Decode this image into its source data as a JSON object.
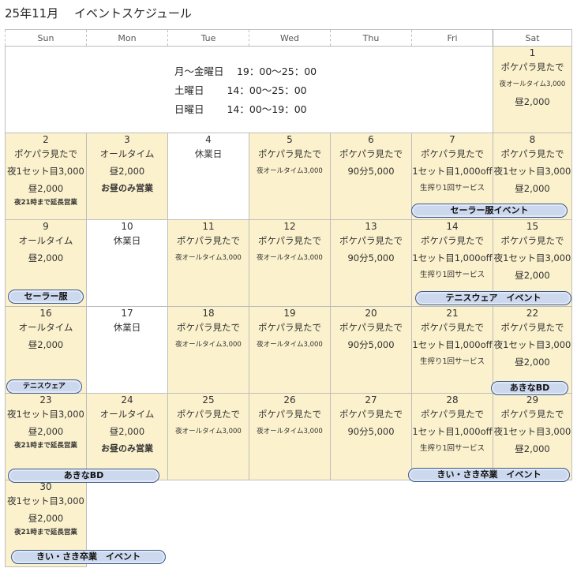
{
  "title": "25年11月　 イベントスケジュール",
  "weekdays": [
    "Sun",
    "Mon",
    "Tue",
    "Wed",
    "Thu",
    "Fri",
    "Sat"
  ],
  "hours": [
    "月～金曜日　 19：00～25：00",
    "土曜日　　 14：00～25：00",
    "日曜日　　 14：00～19：00"
  ],
  "days": {
    "d1": {
      "num": "1",
      "lines": [
        "ポケパラ見たで",
        "夜オールタイム3,000",
        "昼2,000"
      ]
    },
    "d2": {
      "num": "2",
      "lines": [
        "ポケパラ見たで",
        "夜1セット目3,000",
        "昼2,000",
        "夜21時まで延長営業"
      ]
    },
    "d3": {
      "num": "3",
      "lines": [
        "オールタイム",
        "昼2,000",
        "お昼のみ営業"
      ]
    },
    "d4": {
      "num": "4",
      "lines": [
        "休業日"
      ]
    },
    "d5": {
      "num": "5",
      "lines": [
        "ポケパラ見たで",
        "夜オールタイム3,000"
      ]
    },
    "d6": {
      "num": "6",
      "lines": [
        "ポケパラ見たで",
        "90分5,000"
      ]
    },
    "d7": {
      "num": "7",
      "lines": [
        "ポケパラ見たで",
        "1セット目1,000off",
        "生搾り1回サービス"
      ]
    },
    "d8": {
      "num": "8",
      "lines": [
        "ポケパラ見たで",
        "夜1セット目3,000",
        "昼2,000"
      ]
    },
    "d9": {
      "num": "9",
      "lines": [
        "オールタイム",
        "昼2,000"
      ]
    },
    "d10": {
      "num": "10",
      "lines": [
        "休業日"
      ]
    },
    "d11": {
      "num": "11",
      "lines": [
        "ポケパラ見たで",
        "夜オールタイム3,000"
      ]
    },
    "d12": {
      "num": "12",
      "lines": [
        "ポケパラ見たで",
        "夜オールタイム3,000"
      ]
    },
    "d13": {
      "num": "13",
      "lines": [
        "ポケパラ見たで",
        "90分5,000"
      ]
    },
    "d14": {
      "num": "14",
      "lines": [
        "ポケパラ見たで",
        "1セット目1,000off",
        "生搾り1回サービス"
      ]
    },
    "d15": {
      "num": "15",
      "lines": [
        "ポケパラ見たで",
        "夜1セット目3,000",
        "昼2,000"
      ]
    },
    "d16": {
      "num": "16",
      "lines": [
        "オールタイム",
        "昼2,000"
      ]
    },
    "d17": {
      "num": "17",
      "lines": [
        "休業日"
      ]
    },
    "d18": {
      "num": "18",
      "lines": [
        "ポケパラ見たで",
        "夜オールタイム3,000"
      ]
    },
    "d19": {
      "num": "19",
      "lines": [
        "ポケパラ見たで",
        "夜オールタイム3,000"
      ]
    },
    "d20": {
      "num": "20",
      "lines": [
        "ポケパラ見たで",
        "90分5,000"
      ]
    },
    "d21": {
      "num": "21",
      "lines": [
        "ポケパラ見たで",
        "1セット目1,000off",
        "生搾り1回サービス"
      ]
    },
    "d22": {
      "num": "22",
      "lines": [
        "ポケパラ見たで",
        "夜1セット目3,000",
        "昼2,000"
      ]
    },
    "d23": {
      "num": "23",
      "lines": [
        "夜1セット目3,000",
        "昼2,000",
        "夜21時まで延長営業"
      ]
    },
    "d24": {
      "num": "24",
      "lines": [
        "オールタイム",
        "昼2,000",
        "お昼のみ営業"
      ]
    },
    "d25": {
      "num": "25",
      "lines": [
        "ポケパラ見たで",
        "夜オールタイム3,000"
      ]
    },
    "d26": {
      "num": "26",
      "lines": [
        "ポケパラ見たで",
        "夜オールタイム3,000"
      ]
    },
    "d27": {
      "num": "27",
      "lines": [
        "ポケパラ見たで",
        "90分5,000"
      ]
    },
    "d28": {
      "num": "28",
      "lines": [
        "ポケパラ見たで",
        "1セット目1,000off",
        "生搾り1回サービス"
      ]
    },
    "d29": {
      "num": "29",
      "lines": [
        "ポケパラ見たで",
        "夜1セット目3,000",
        "昼2,000"
      ]
    },
    "d30": {
      "num": "30",
      "lines": [
        "夜1セット目3,000",
        "昼2,000",
        "夜21時まで延長営業"
      ]
    }
  },
  "events": {
    "e1": "セーラー服イベント",
    "e2": "セーラー服",
    "e3": "テニスウェア　イベント",
    "e4": "テニスウェア",
    "e5": "あきなBD",
    "e6": "あきなBD",
    "e7": "きい・さき卒業　イベント",
    "e8": "きい・さき卒業　イベント"
  },
  "colors": {
    "cell_fill": "#fbf1cc",
    "cloud_fill": "#ccd8ee",
    "cloud_border": "#3c5a8c"
  }
}
